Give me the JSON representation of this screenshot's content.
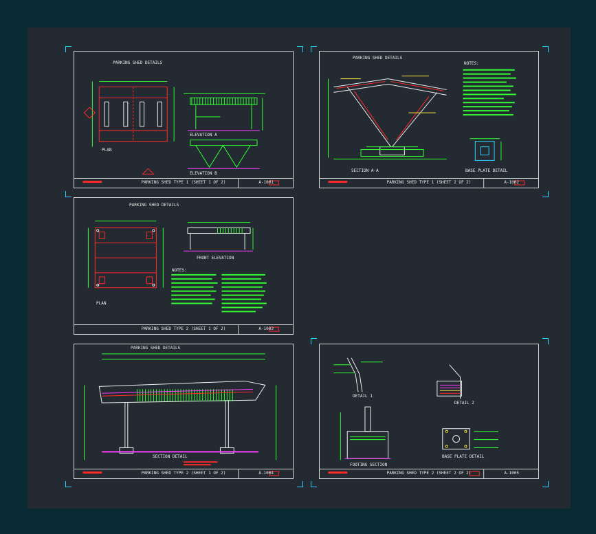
{
  "sheets": [
    {
      "title": "PARKING SHED DETAILS",
      "footer": "PARKING SHED TYPE 1 (SHEET 1 OF 2)",
      "number": "A-1001",
      "labels": {
        "plan": "PLAN",
        "elev_a": "ELEVATION A",
        "elev_b": "ELEVATION B"
      }
    },
    {
      "title": "PARKING SHED DETAILS",
      "footer": "PARKING SHED TYPE 1 (SHEET 2 OF 2)",
      "number": "A-1002",
      "labels": {
        "notes": "NOTES:",
        "section": "SECTION A-A",
        "base": "BASE PLATE DETAIL"
      }
    },
    {
      "title": "PARKING SHED DETAILS",
      "footer": "PARKING SHED TYPE 2 (SHEET 1 OF 2)",
      "number": "A-1003",
      "labels": {
        "plan": "PLAN",
        "front": "FRONT ELEVATION",
        "notes": "NOTES:"
      }
    },
    {
      "title": "PARKING SHED DETAILS",
      "footer": "PARKING SHED TYPE 2 (SHEET 1 OF 2)",
      "number": "A-1004",
      "labels": {
        "section": "SECTION DETAIL"
      }
    },
    {
      "title": "",
      "footer": "PARKING SHED TYPE 2 (SHEET 2 OF 2)",
      "number": "A-1005",
      "labels": {
        "detail1": "DETAIL 1",
        "detail2": "DETAIL 2",
        "footing": "FOOTING SECTION",
        "base": "BASE PLATE DETAIL"
      }
    }
  ],
  "colors": {
    "background": "#082a33",
    "canvas": "#232a31",
    "frame": "#d8d8d8",
    "red": "#ff2a2a",
    "green": "#33ff33",
    "cyan": "#2fd3ff",
    "yellow": "#ffe640",
    "magenta": "#ff3cff",
    "white": "#f0f0f0"
  }
}
